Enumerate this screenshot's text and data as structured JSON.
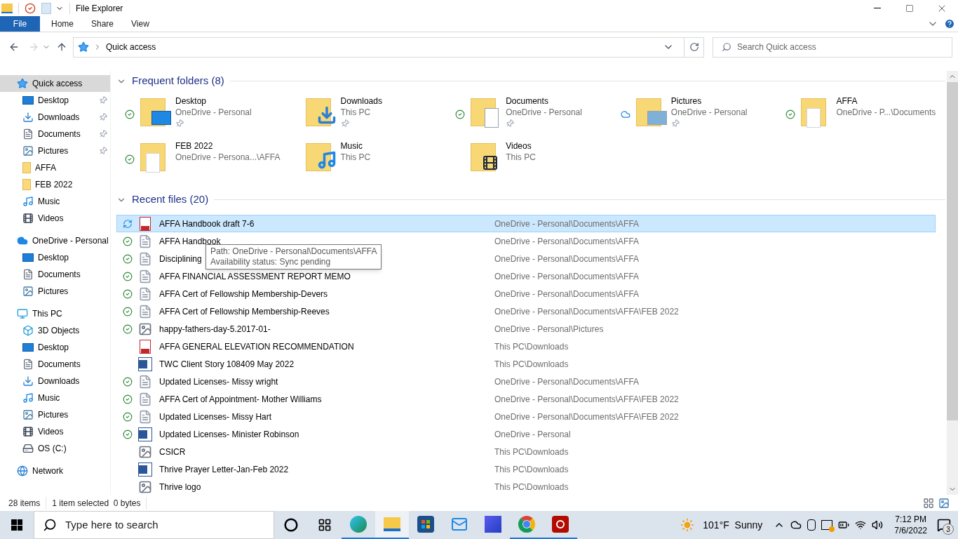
{
  "window": {
    "title": "File Explorer"
  },
  "ribbon_tabs": [
    {
      "label": "File",
      "selected": true
    },
    {
      "label": "Home",
      "selected": false
    },
    {
      "label": "Share",
      "selected": false
    },
    {
      "label": "View",
      "selected": false
    }
  ],
  "address": {
    "path": "Quick access"
  },
  "search": {
    "placeholder": "Search Quick access"
  },
  "sidebar": {
    "items": [
      {
        "label": "Quick access",
        "kind": "star",
        "selected": true,
        "children": [
          {
            "label": "Desktop",
            "kind": "desktop",
            "pinned": true
          },
          {
            "label": "Downloads",
            "kind": "download",
            "pinned": true
          },
          {
            "label": "Documents",
            "kind": "document",
            "pinned": true
          },
          {
            "label": "Pictures",
            "kind": "picture",
            "pinned": true
          },
          {
            "label": "AFFA",
            "kind": "folder",
            "pinned": false
          },
          {
            "label": "FEB 2022",
            "kind": "folder",
            "pinned": false
          },
          {
            "label": "Music",
            "kind": "music",
            "pinned": false
          },
          {
            "label": "Videos",
            "kind": "video",
            "pinned": false
          }
        ]
      },
      {
        "label": "OneDrive - Personal",
        "kind": "cloud",
        "selected": false,
        "children": [
          {
            "label": "Desktop",
            "kind": "desktop",
            "pinned": false
          },
          {
            "label": "Documents",
            "kind": "document",
            "pinned": false
          },
          {
            "label": "Pictures",
            "kind": "picture",
            "pinned": false
          }
        ]
      },
      {
        "label": "This PC",
        "kind": "pc",
        "selected": false,
        "children": [
          {
            "label": "3D Objects",
            "kind": "cube",
            "pinned": false
          },
          {
            "label": "Desktop",
            "kind": "desktop",
            "pinned": false
          },
          {
            "label": "Documents",
            "kind": "document",
            "pinned": false
          },
          {
            "label": "Downloads",
            "kind": "download",
            "pinned": false
          },
          {
            "label": "Music",
            "kind": "music",
            "pinned": false
          },
          {
            "label": "Pictures",
            "kind": "picture",
            "pinned": false
          },
          {
            "label": "Videos",
            "kind": "video",
            "pinned": false
          },
          {
            "label": "OS (C:)",
            "kind": "drive",
            "pinned": false
          }
        ]
      },
      {
        "label": "Network",
        "kind": "network",
        "selected": false
      }
    ]
  },
  "frequent_folders": {
    "title": "Frequent folders (8)",
    "items": [
      {
        "name": "Desktop",
        "location": "OneDrive - Personal",
        "synced": true,
        "online_only": false,
        "kind": "desktop",
        "pinned": true
      },
      {
        "name": "Downloads",
        "location": "This PC",
        "synced": false,
        "online_only": false,
        "kind": "download",
        "pinned": true
      },
      {
        "name": "Documents",
        "location": "OneDrive - Personal",
        "synced": true,
        "online_only": false,
        "kind": "document",
        "pinned": true
      },
      {
        "name": "Pictures",
        "location": "OneDrive - Personal",
        "synced": false,
        "online_only": true,
        "kind": "picture",
        "pinned": true
      },
      {
        "name": "AFFA",
        "location": "OneDrive - P...\\Documents",
        "synced": true,
        "online_only": false,
        "kind": "files",
        "pinned": false
      },
      {
        "name": "FEB 2022",
        "location": "OneDrive - Persona...\\AFFA",
        "synced": true,
        "online_only": false,
        "kind": "files",
        "pinned": false
      },
      {
        "name": "Music",
        "location": "This PC",
        "synced": false,
        "online_only": false,
        "kind": "music",
        "pinned": false
      },
      {
        "name": "Videos",
        "location": "This PC",
        "synced": false,
        "online_only": false,
        "kind": "video",
        "pinned": false
      }
    ]
  },
  "recent_files": {
    "title": "Recent files (20)",
    "rows": [
      {
        "name": "AFFA Handbook draft 7-6",
        "path": "OneDrive - Personal\\Documents\\AFFA",
        "synced": false,
        "sync_pending": true,
        "kind": "pdf",
        "selected": true
      },
      {
        "name": "AFFA Handbook",
        "path": "OneDrive - Personal\\Documents\\AFFA",
        "synced": true,
        "sync_pending": false,
        "kind": "doc",
        "selected": false
      },
      {
        "name": "Disciplining",
        "path": "OneDrive - Personal\\Documents\\AFFA",
        "synced": true,
        "sync_pending": false,
        "kind": "doc",
        "selected": false
      },
      {
        "name": "AFFA FINANCIAL ASSESSMENT REPORT MEMO",
        "path": "OneDrive - Personal\\Documents\\AFFA",
        "synced": true,
        "sync_pending": false,
        "kind": "doc",
        "selected": false
      },
      {
        "name": "AFFA Cert of Fellowship Membership-Devers",
        "path": "OneDrive - Personal\\Documents\\AFFA",
        "synced": true,
        "sync_pending": false,
        "kind": "doc",
        "selected": false
      },
      {
        "name": "AFFA Cert of Fellowship Membership-Reeves",
        "path": "OneDrive - Personal\\Documents\\AFFA\\FEB 2022",
        "synced": true,
        "sync_pending": false,
        "kind": "doc",
        "selected": false
      },
      {
        "name": "happy-fathers-day-5.2017-01-",
        "path": "OneDrive - Personal\\Pictures",
        "synced": true,
        "sync_pending": false,
        "kind": "image",
        "selected": false
      },
      {
        "name": "AFFA GENERAL ELEVATION RECOMMENDATION",
        "path": "This PC\\Downloads",
        "synced": false,
        "sync_pending": false,
        "kind": "pdf",
        "selected": false
      },
      {
        "name": "TWC Client Story 108409 May 2022",
        "path": "This PC\\Downloads",
        "synced": false,
        "sync_pending": false,
        "kind": "word",
        "selected": false
      },
      {
        "name": "Updated Licenses- Missy wright",
        "path": "OneDrive - Personal\\Documents\\AFFA",
        "synced": true,
        "sync_pending": false,
        "kind": "doc",
        "selected": false
      },
      {
        "name": "AFFA Cert of Appointment- Mother Williams",
        "path": "OneDrive - Personal\\Documents\\AFFA\\FEB 2022",
        "synced": true,
        "sync_pending": false,
        "kind": "doc",
        "selected": false
      },
      {
        "name": "Updated Licenses- Missy Hart",
        "path": "OneDrive - Personal\\Documents\\AFFA\\FEB 2022",
        "synced": true,
        "sync_pending": false,
        "kind": "doc",
        "selected": false
      },
      {
        "name": "Updated Licenses- Minister Robinson",
        "path": "OneDrive - Personal",
        "synced": true,
        "sync_pending": false,
        "kind": "word",
        "selected": false
      },
      {
        "name": "CSICR",
        "path": "This PC\\Downloads",
        "synced": false,
        "sync_pending": false,
        "kind": "image",
        "selected": false
      },
      {
        "name": "Thrive Prayer Letter-Jan-Feb 2022",
        "path": "This PC\\Downloads",
        "synced": false,
        "sync_pending": false,
        "kind": "word",
        "selected": false
      },
      {
        "name": "Thrive logo",
        "path": "This PC\\Downloads",
        "synced": false,
        "sync_pending": false,
        "kind": "image",
        "selected": false
      }
    ]
  },
  "tooltip": {
    "lines": [
      "Path: OneDrive - Personal\\Documents\\AFFA",
      "Availability status: Sync pending"
    ]
  },
  "status_bar": {
    "items": "28 items",
    "selection": "1 item selected  0 bytes"
  },
  "taskbar": {
    "search_placeholder": "Type here to search",
    "apps": [
      {
        "kind": "edge",
        "active": true
      },
      {
        "kind": "explorer",
        "active": true
      },
      {
        "kind": "store",
        "active": false
      },
      {
        "kind": "mail",
        "active": false
      },
      {
        "kind": "m365",
        "active": false
      },
      {
        "kind": "chrome",
        "active": true
      },
      {
        "kind": "acrobat",
        "active": true
      }
    ],
    "weather": "101°F  Sunny",
    "time": "7:12 PM",
    "date": "7/6/2022",
    "notifications": "3"
  }
}
